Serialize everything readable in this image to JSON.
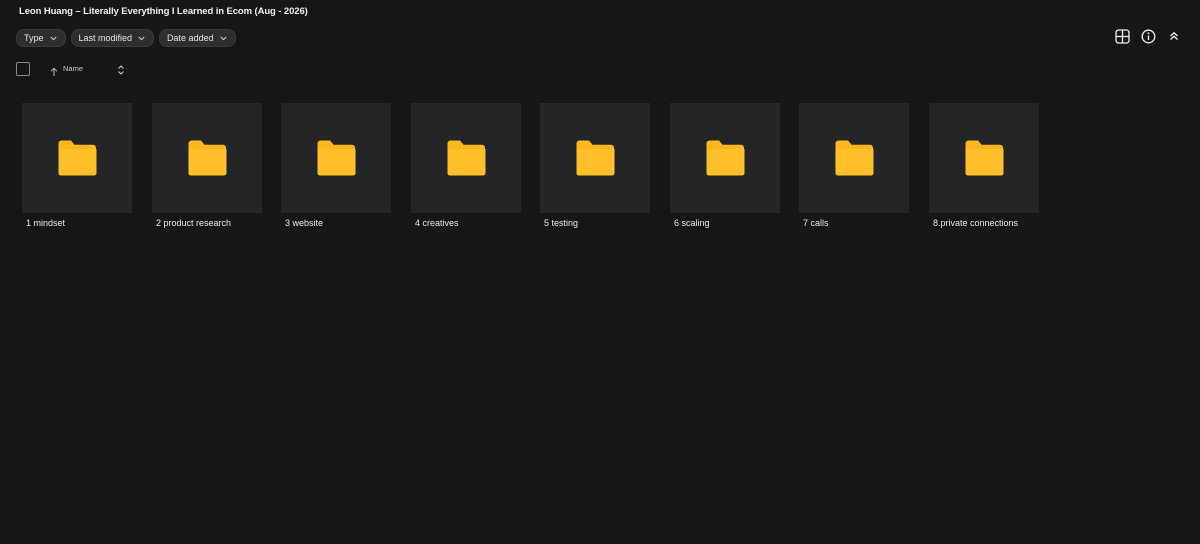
{
  "title": "Leon Huang – Literally Everything I Learned in Ecom (Aug - 2026)",
  "filters": [
    {
      "label": "Type"
    },
    {
      "label": "Last modified"
    },
    {
      "label": "Date added"
    }
  ],
  "toolbar_icons": [
    "grid-view-icon",
    "info-icon",
    "collapse-icon"
  ],
  "list_header": {
    "name_label": "Name",
    "sort_direction": "ascending"
  },
  "folder_color": "#FFB71B",
  "folders": [
    {
      "name": "1 mindset"
    },
    {
      "name": "2 product research"
    },
    {
      "name": "3 website"
    },
    {
      "name": "4 creatives"
    },
    {
      "name": "5 testing"
    },
    {
      "name": "6 scaling"
    },
    {
      "name": "7 calls"
    },
    {
      "name": "8.private connections"
    }
  ]
}
